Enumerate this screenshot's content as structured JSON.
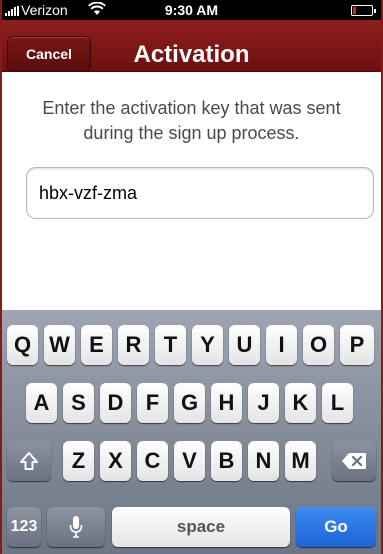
{
  "status_bar": {
    "carrier": "Verizon",
    "time": "9:30 AM"
  },
  "nav": {
    "cancel_label": "Cancel",
    "title": "Activation"
  },
  "content": {
    "instructions": "Enter the activation key that was sent during the sign up process.",
    "key_value": "hbx-vzf-zma"
  },
  "keyboard": {
    "row1": [
      "Q",
      "W",
      "E",
      "R",
      "T",
      "Y",
      "U",
      "I",
      "O",
      "P"
    ],
    "row2": [
      "A",
      "S",
      "D",
      "F",
      "G",
      "H",
      "J",
      "K",
      "L"
    ],
    "row3": [
      "Z",
      "X",
      "C",
      "V",
      "B",
      "N",
      "M"
    ],
    "numbers_label": "123",
    "space_label": "space",
    "go_label": "Go"
  },
  "colors": {
    "nav_bar": "#7f1717",
    "go_key": "#2a74e4",
    "keyboard_bg": "#858c99"
  }
}
